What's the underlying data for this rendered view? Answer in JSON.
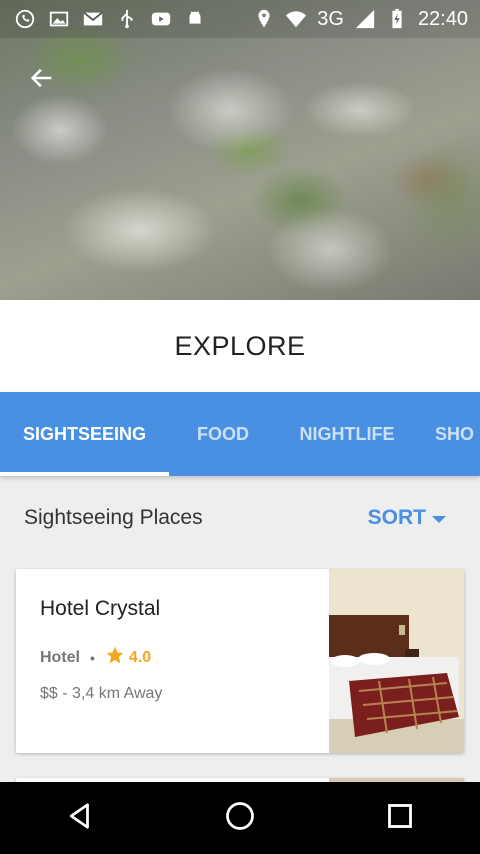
{
  "status_bar": {
    "network": "3G",
    "time": "22:40",
    "left_icons": [
      "whatsapp-icon",
      "image-icon",
      "gmail-icon",
      "usb-icon",
      "youtube-icon",
      "android-icon"
    ],
    "right_icons": [
      "location-icon",
      "wifi-icon",
      "signal-icon",
      "battery-charging-icon"
    ]
  },
  "header": {
    "title": "EXPLORE",
    "back_icon": "arrow-back-icon"
  },
  "tabs": [
    {
      "label": "SIGHTSEEING",
      "active": true
    },
    {
      "label": "FOOD",
      "active": false
    },
    {
      "label": "NIGHTLIFE",
      "active": false
    },
    {
      "label": "SHO",
      "active": false
    }
  ],
  "section": {
    "title": "Sightseeing Places",
    "sort_label": "SORT",
    "sort_icon": "caret-down-icon"
  },
  "places": [
    {
      "name": "Hotel Crystal",
      "category": "Hotel",
      "rating": "4.0",
      "price_distance": "$$ - 3,4 km Away"
    }
  ],
  "colors": {
    "primary": "#4a90e2",
    "rating": "#f5a623",
    "text_dark": "#222222",
    "text_muted": "#777777"
  },
  "nav_bar": {
    "icons": [
      "back-triangle-icon",
      "home-circle-icon",
      "recents-square-icon"
    ]
  }
}
